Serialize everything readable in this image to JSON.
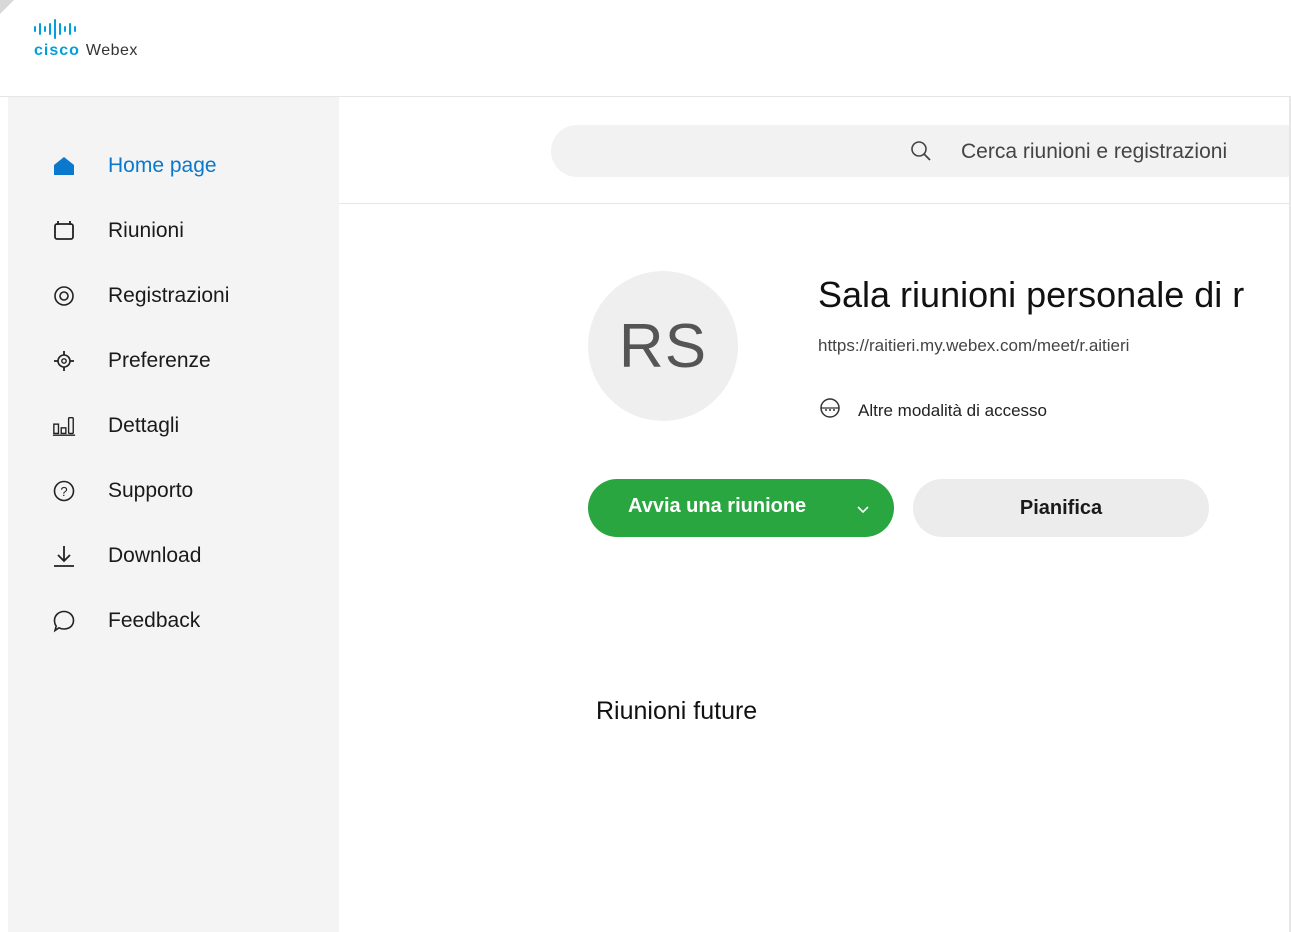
{
  "header": {
    "logo_brand": "cisco",
    "logo_product": "Webex"
  },
  "sidebar": {
    "items": [
      {
        "label": "Home page",
        "icon": "home-icon",
        "active": true
      },
      {
        "label": "Riunioni",
        "icon": "meetings-icon",
        "active": false
      },
      {
        "label": "Registrazioni",
        "icon": "recordings-icon",
        "active": false
      },
      {
        "label": "Preferenze",
        "icon": "preferences-gear-icon",
        "active": false
      },
      {
        "label": "Dettagli",
        "icon": "insights-bars-icon",
        "active": false
      },
      {
        "label": "Supporto",
        "icon": "help-question-icon",
        "active": false
      },
      {
        "label": "Download",
        "icon": "download-arrow-icon",
        "active": false
      },
      {
        "label": "Feedback",
        "icon": "feedback-bubble-icon",
        "active": false
      }
    ]
  },
  "search": {
    "placeholder": "Cerca riunioni e registrazioni",
    "icon": "search-icon"
  },
  "room": {
    "avatar_initials": "RS",
    "title": "Sala riunioni personale di r",
    "url": "https://raitieri.my.webex.com/meet/r.aitieri",
    "access_label": "Altre modalità di accesso",
    "access_icon": "globe-phone-icon"
  },
  "actions": {
    "start_label": "Avvia una riunione",
    "schedule_label": "Pianifica"
  },
  "upcoming": {
    "heading": "Riunioni future"
  },
  "colors": {
    "accent_blue": "#0a78cc",
    "cisco_blue": "#049fd9",
    "start_green": "#2aa640",
    "sidebar_bg": "#f4f4f4"
  }
}
